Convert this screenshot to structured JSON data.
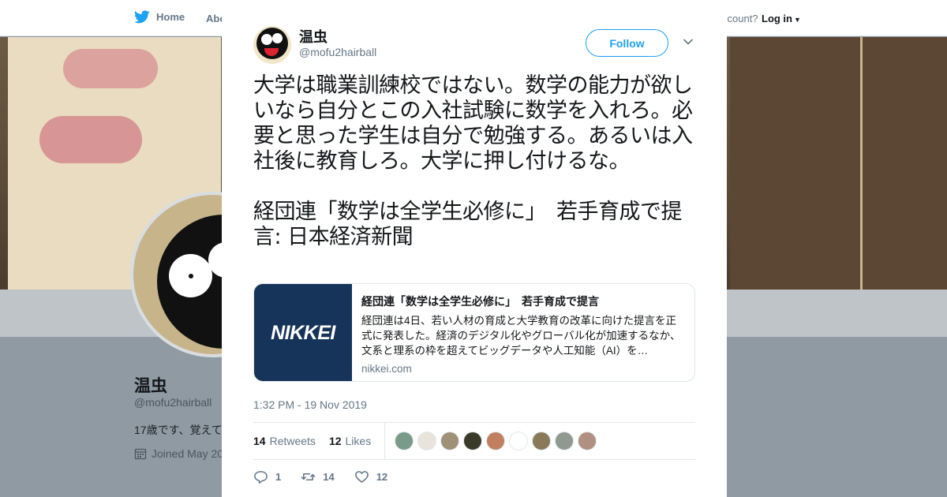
{
  "topnav": {
    "home_label": "Home",
    "about_label": "Abo",
    "account_text": "ccount?",
    "login_label": "Log in"
  },
  "profile": {
    "name": "温虫",
    "handle": "@mofu2hairball",
    "bio": "17歳です、覚えて",
    "joined": "Joined May 20"
  },
  "tweet": {
    "author_name": "温虫",
    "author_handle": "@mofu2hairball",
    "follow_label": "Follow",
    "text_paragraph_1": "大学は職業訓練校ではない。数学の能力が欲しいなら自分とこの入社試験に数学を入れろ。必要と思った学生は自分で勉強する。あるいは入社後に教育しろ。大学に押し付けるな。",
    "text_paragraph_2": "経団連「数学は全学生必修に」　若手育成で提言: 日本経済新聞",
    "timestamp": "1:32 PM - 19 Nov 2019",
    "card": {
      "thumb_text": "NIKKEI",
      "title": "経団連「数学は全学生必修に」　若手育成で提言",
      "description": "経団連は4日、若い人材の育成と大学教育の改革に向けた提言を正式に発表した。経済のデジタル化やグローバル化が加速するなか、文系と理系の枠を超えてビッグデータや人工知能（AI）を…",
      "domain": "nikkei.com"
    },
    "stats": {
      "retweets_count": "14",
      "retweets_label": "Retweets",
      "likes_count": "12",
      "likes_label": "Likes"
    },
    "liker_colors": [
      "#7a9a8a",
      "#e8e4dc",
      "#a09078",
      "#3a3a2a",
      "#c08060",
      "#ffffff",
      "#8a7a5a",
      "#909890",
      "#b09080"
    ],
    "actions": {
      "reply_count": "1",
      "retweet_count": "14",
      "like_count": "12"
    },
    "accent_color": "#1da1f2"
  }
}
